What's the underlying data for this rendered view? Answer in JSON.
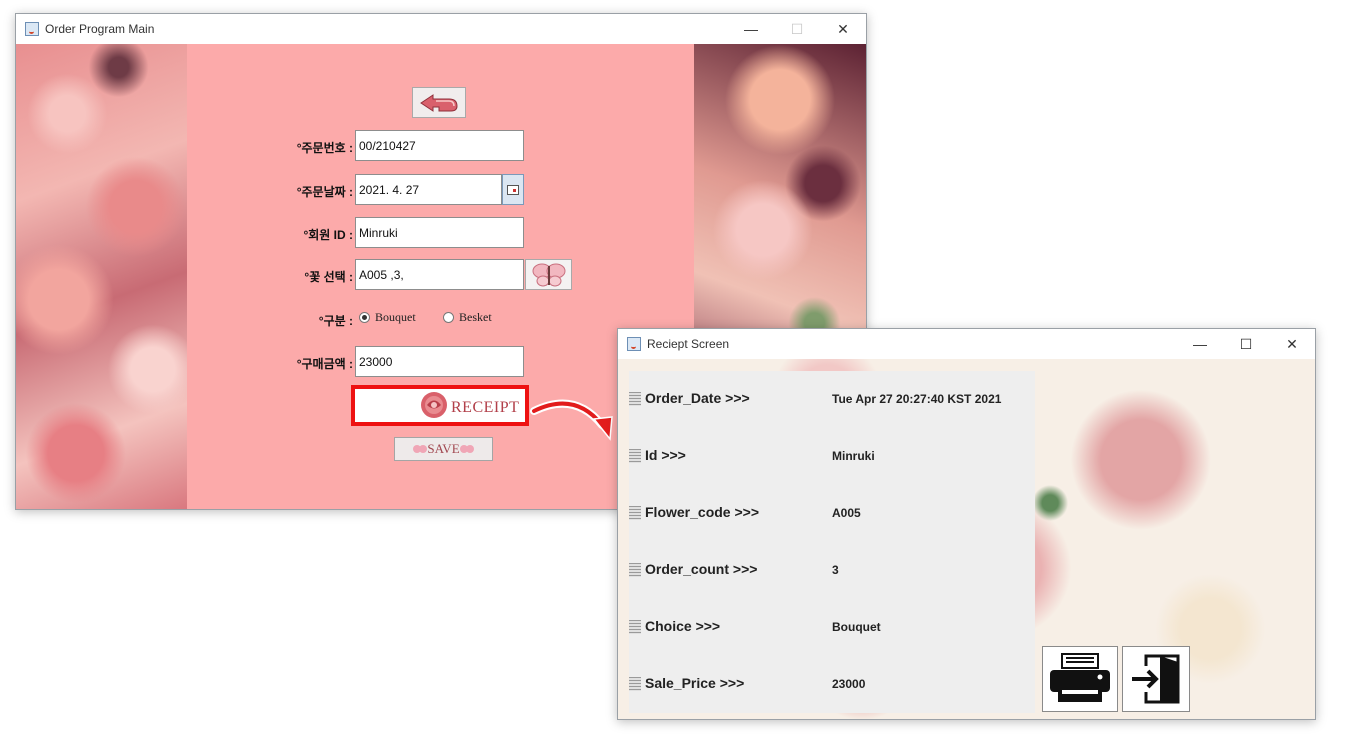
{
  "order_window": {
    "title": "Order Program Main",
    "fields": [
      {
        "label": "°주문번호 :",
        "value": "00/210427"
      },
      {
        "label": "°주문날짜 :",
        "value": "2021. 4. 27"
      },
      {
        "label": "°회원 ID :",
        "value": "Minruki"
      },
      {
        "label": "°꽃 선택 :",
        "value": "A005  ,3,"
      },
      {
        "label": "°구분 :"
      },
      {
        "label": "°구매금액 :",
        "value": "23000"
      }
    ],
    "radios": [
      {
        "label": "Bouquet",
        "selected": true
      },
      {
        "label": "Besket",
        "selected": false
      }
    ],
    "receipt_label": "RECEIPT",
    "save_label": "SAVE"
  },
  "receipt_window": {
    "title": "Reciept Screen",
    "rows": [
      {
        "key": "Order_Date >>>",
        "value": "Tue Apr 27 20:27:40 KST 2021"
      },
      {
        "key": "Id >>>",
        "value": "Minruki"
      },
      {
        "key": "Flower_code >>>",
        "value": "A005"
      },
      {
        "key": "Order_count >>>",
        "value": "3"
      },
      {
        "key": "Choice >>>",
        "value": "Bouquet"
      },
      {
        "key": "Sale_Price >>>",
        "value": "23000"
      }
    ]
  },
  "colors": {
    "order_background": "#fcaaaa",
    "highlight_border": "#ee1111",
    "arrow": "#e21c1c"
  }
}
